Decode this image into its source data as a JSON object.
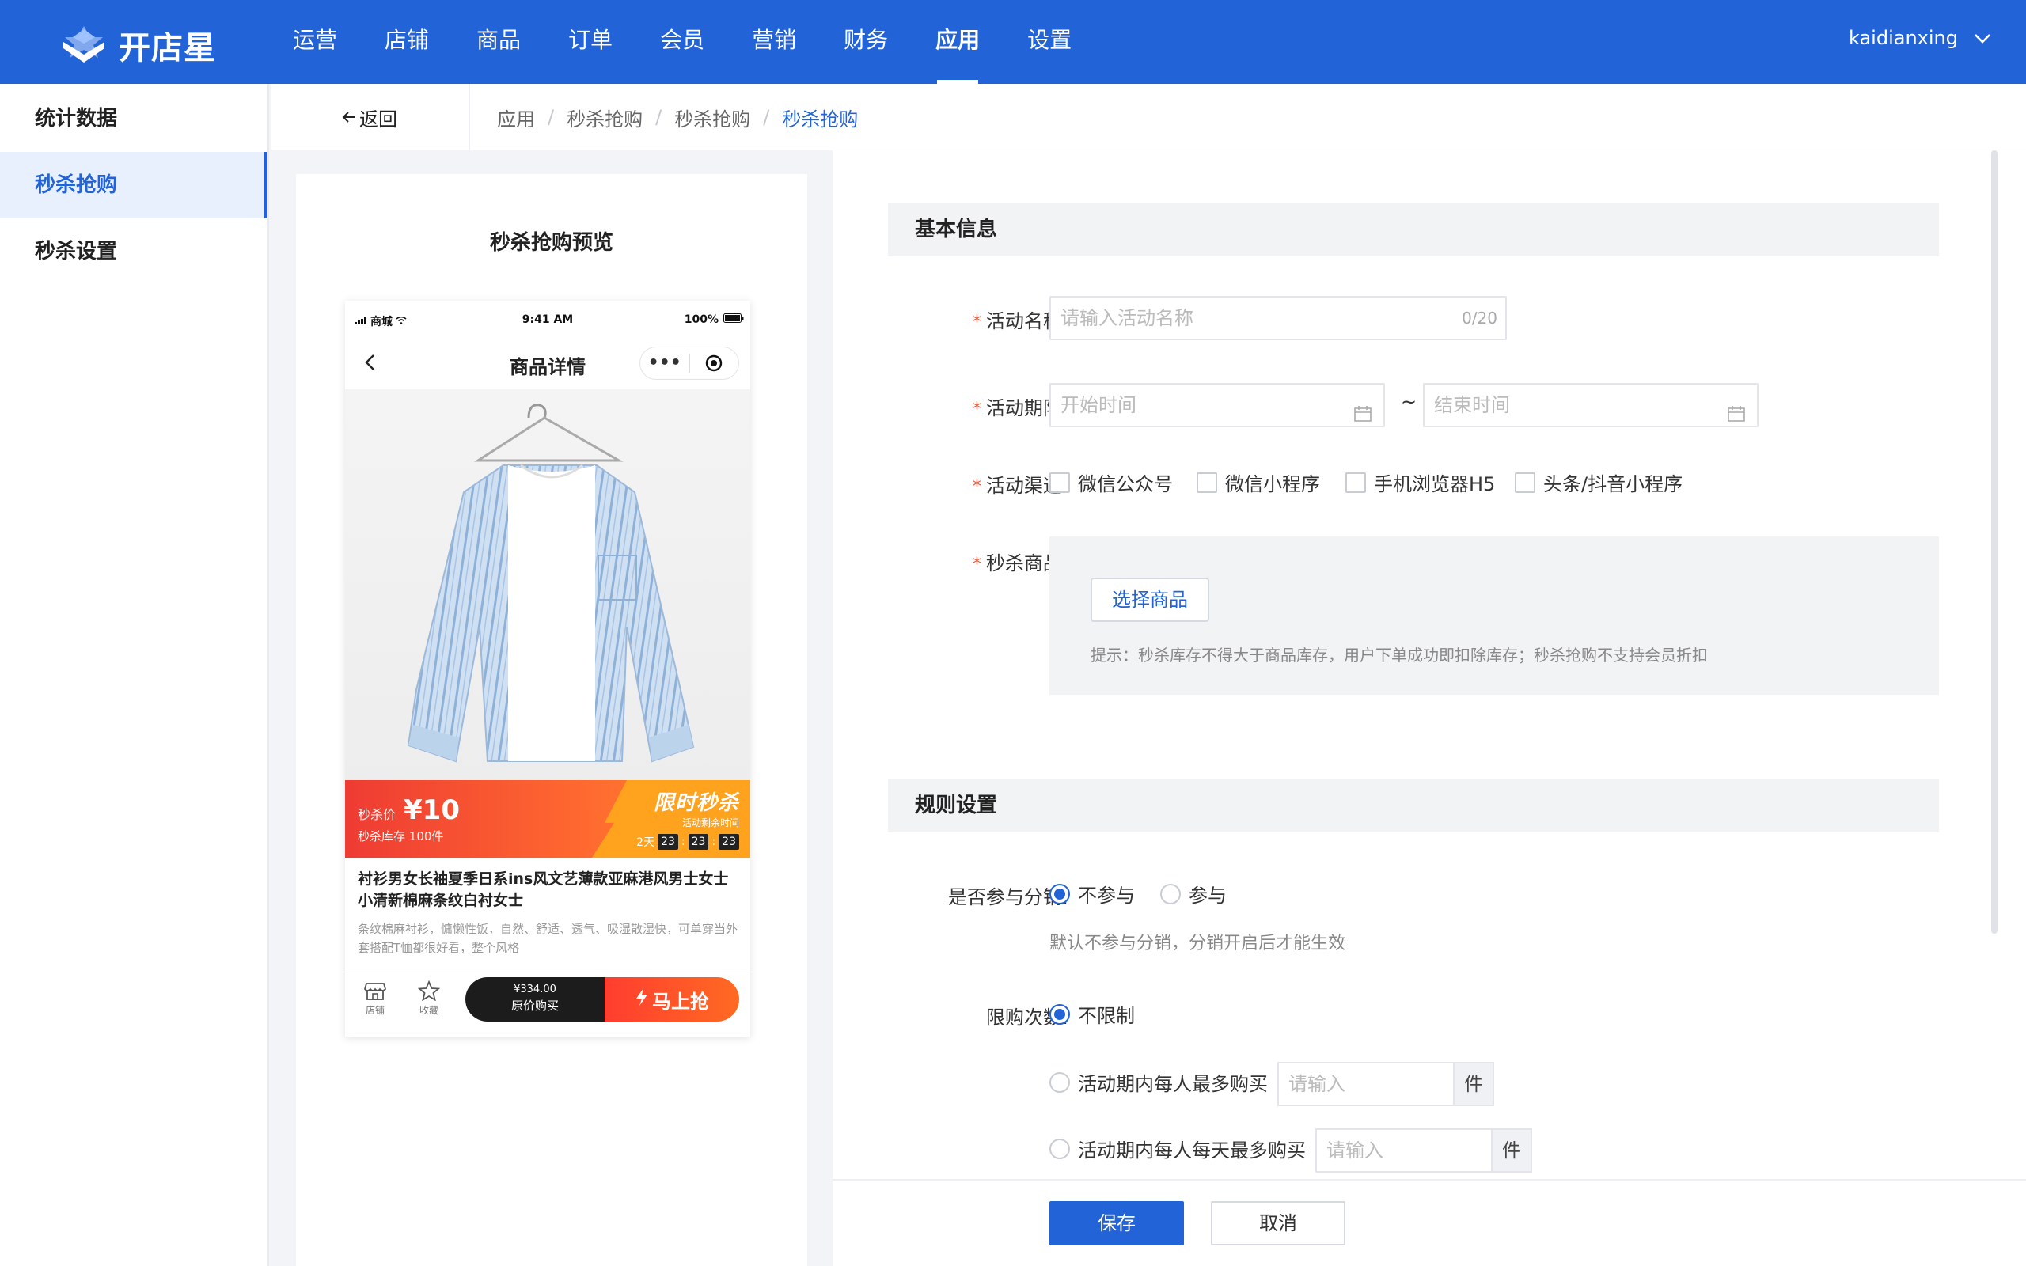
{
  "brand": {
    "name": "开店星",
    "accent": "#2264d8"
  },
  "nav": {
    "items": [
      "运营",
      "店铺",
      "商品",
      "订单",
      "会员",
      "营销",
      "财务",
      "应用",
      "设置"
    ],
    "active": "应用"
  },
  "user": {
    "name": "kaidianxing"
  },
  "sidebar": {
    "items": [
      {
        "label": "统计数据",
        "active": false
      },
      {
        "label": "秒杀抢购",
        "active": true
      },
      {
        "label": "秒杀设置",
        "active": false
      }
    ]
  },
  "breadcrumb": {
    "back": "返回",
    "items": [
      "应用",
      "秒杀抢购",
      "秒杀抢购",
      "秒杀抢购"
    ]
  },
  "preview": {
    "title": "秒杀抢购预览",
    "status": {
      "carrier": "商城",
      "time": "9:41 AM",
      "battery": "100%"
    },
    "page_title": "商品详情",
    "capsule_dots": "•••",
    "price_label": "秒杀价",
    "price": "¥10",
    "stock_label": "秒杀库存",
    "stock": "100件",
    "promo_big": "限时秒杀",
    "promo_small": "活动剩余时间",
    "countdown": {
      "days": "2天",
      "h": "23",
      "m": "23",
      "s": "23"
    },
    "product_title": "衬衫男女长袖夏季日系ins风文艺薄款亚麻港风男士女士小清新棉麻条纹白衬女士",
    "product_desc": "条纹棉麻衬衫，慵懒性饭，自然、舒适、透气、吸湿散湿快，可单穿当外套搭配T恤都很好看，整个风格",
    "bottom": {
      "store": "店铺",
      "fav": "收藏",
      "original_price": "¥334.00",
      "original_label": "原价购买",
      "buy_now": "马上抢"
    }
  },
  "form": {
    "basic_section": "基本信息",
    "name": {
      "label": "活动名称:",
      "placeholder": "请输入活动名称",
      "counter": "0/20"
    },
    "period": {
      "label": "活动期限:",
      "start_placeholder": "开始时间",
      "end_placeholder": "结束时间",
      "sep": "~"
    },
    "channels": {
      "label": "活动渠道:",
      "options": [
        "微信公众号",
        "微信小程序",
        "手机浏览器H5",
        "头条/抖音小程序"
      ]
    },
    "goods": {
      "label": "秒杀商品:",
      "button": "选择商品",
      "hint": "提示：秒杀库存不得大于商品库存，用户下单成功即扣除库存；秒杀抢购不支持会员折扣"
    },
    "rules_section": "规则设置",
    "distribution": {
      "label": "是否参与分销:",
      "options": [
        "不参与",
        "参与"
      ],
      "selected": "不参与",
      "hint": "默认不参与分销，分销开启后才能生效"
    },
    "limit": {
      "label": "限购次数:",
      "options": [
        "不限制",
        "活动期内每人最多购买",
        "活动期内每人每天最多购买"
      ],
      "selected": "不限制",
      "input_placeholder": "请输入",
      "unit": "件"
    },
    "save": "保存",
    "cancel": "取消"
  }
}
